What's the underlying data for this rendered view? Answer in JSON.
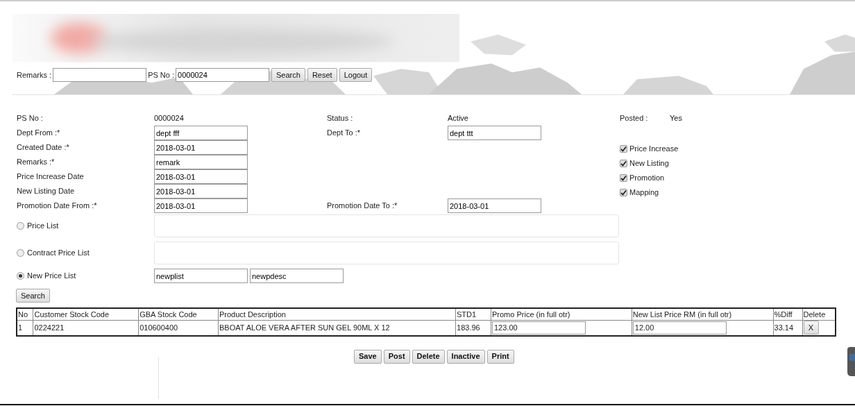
{
  "toolbar": {
    "fields": [
      {
        "label": "Remarks :"
      },
      {
        "label": "PS No :",
        "value": "0000024"
      }
    ],
    "buttons": [
      "Search",
      "Reset",
      "Logout"
    ]
  },
  "form": {
    "rows": [
      {
        "left": {
          "kind": "text",
          "label": "PS No :",
          "value": "0000024"
        },
        "middle": {
          "kind": "text",
          "label": "Status :",
          "value": "Active"
        },
        "right": {
          "kind": "text",
          "label": "Posted :",
          "value": "Yes"
        }
      },
      {
        "left": {
          "kind": "input",
          "label": "Dept From :*",
          "value": "dept fff"
        },
        "middle": {
          "kind": "input",
          "label": "Dept To :*",
          "value": "dept ttt"
        }
      },
      {
        "left": {
          "kind": "input",
          "label": "Created Date :*",
          "value": "2018-03-01"
        },
        "right": {
          "kind": "checkbox",
          "label": "Price Increase",
          "checked": true
        }
      },
      {
        "left": {
          "kind": "input",
          "label": "Remarks :*",
          "value": "remark"
        },
        "right": {
          "kind": "checkbox",
          "label": "New Listing",
          "checked": true
        }
      },
      {
        "left": {
          "kind": "input",
          "label": "Price Increase Date",
          "value": "2018-03-01"
        },
        "right": {
          "kind": "checkbox",
          "label": "Promotion",
          "checked": true
        }
      },
      {
        "left": {
          "kind": "input",
          "label": "New Listing Date",
          "value": "2018-03-01"
        },
        "right": {
          "kind": "checkbox",
          "label": "Mapping",
          "checked": true
        }
      },
      {
        "left": {
          "kind": "input",
          "label": "Promotion Date From :*",
          "value": "2018-03-01"
        },
        "middle": {
          "kind": "input",
          "label": "Promotion Date To :*",
          "value": "2018-03-01"
        }
      }
    ]
  },
  "price_lists": [
    {
      "kind": "box",
      "label": "Price List",
      "selected": false
    },
    {
      "kind": "box",
      "label": "Contract Price List",
      "selected": false
    },
    {
      "kind": "inputs",
      "label": "New Price List",
      "selected": true,
      "values": [
        "newplist",
        "newpdesc"
      ]
    }
  ],
  "search_button": "Search",
  "table": {
    "columns": [
      "No",
      "Customer Stock Code",
      "GBA Stock Code",
      "Product Description",
      "STD1",
      "Promo Price (in full otr)",
      "New List Price RM (in full otr)",
      "%Diff",
      "Delete"
    ],
    "rows": [
      {
        "cells": [
          {
            "kind": "text",
            "text": "1"
          },
          {
            "kind": "text",
            "text": "0224221"
          },
          {
            "kind": "text",
            "text": "010600400"
          },
          {
            "kind": "text",
            "text": "BBOAT ALOE VERA AFTER SUN GEL 90ML X 12"
          },
          {
            "kind": "text",
            "text": "183.96"
          },
          {
            "kind": "input",
            "text": "123.00"
          },
          {
            "kind": "input",
            "text": "12.00"
          },
          {
            "kind": "text",
            "text": "33.14"
          },
          {
            "kind": "button",
            "text": "X"
          }
        ]
      }
    ]
  },
  "actions": [
    "Save",
    "Post",
    "Delete",
    "Inactive",
    "Print"
  ]
}
